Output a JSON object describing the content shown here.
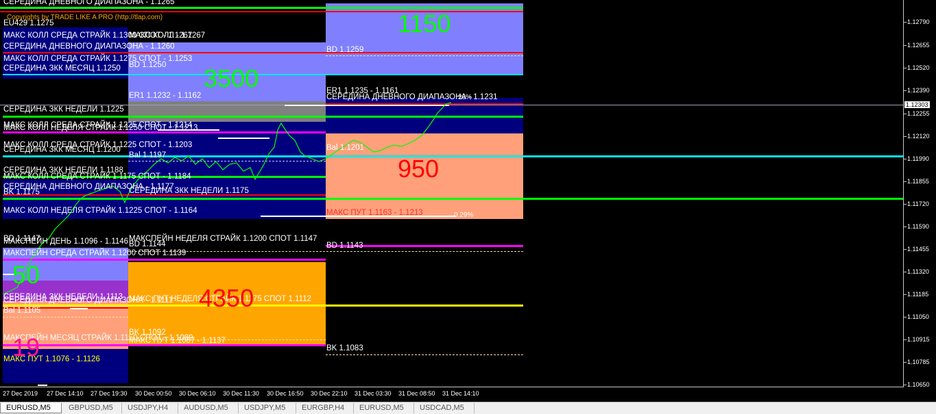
{
  "copyright": "Copyrights by TRADE LIKE A PRO (http://tlap.com)",
  "top_cut_label": "СЕРЕДИНА ДНЕВНОГО ДИАПАЗОНА - 1.1265",
  "labels": {
    "eu429": "EU429 1.1275",
    "maks_koll_sreda_1": "МАКС КОЛЛ СРЕДА  СТРАЙК 1.1300 СПОТ - 1.1267",
    "maks_koll_sreda_1b": "МАКС КОЛЛ - 1.1267",
    "ser_dnev_1": "СЕРЕДИНА ДНЕВНОГО ДИАПАЗОНА - 1.1260",
    "maks_koll_sreda_2": "МАКС КОЛЛ СРЕДА  СТРАЙК 1.1275 СПОТ - 1.1253",
    "ser_zkk_mes_1": "СЕРЕДИНА ЗКК МЕСЯЦ 1.1250",
    "ser_zkk_ned_1": "СЕРЕДИНА ЗКК НЕДЕЛИ 1.1225",
    "maks_koll_sreda_3": "МАКС КОЛЛ СРЕДА  СТРАЙК 1.1225 СПОТ - 1.1214",
    "maks_koll_ned_1": "МАКС КОЛЛ НЕДЕЛЯ СТРАЙК 1.1250 СПОТ - 1.1213",
    "maks_koll_sreda_4": "МАКС КОЛЛ СРЕДА  СТРАЙК 1.1225 СПОТ - 1.1203",
    "ser_zkk_mes_2": "СЕРЕДИНА ЗКК МЕСЯЦ 1.1200",
    "ser_zkk_ned_2": "СЕРЕДИНА ЗКК НЕДЕЛИ 1.1188",
    "maks_koll_sreda_5": "МАКС КОЛЛ СРЕДА  СТРАЙК 1.1175 СПОТ - 1.1184",
    "ser_dnev_2": "СЕРЕДИНА ДНЕВНОГО ДИАПАЗОНА - 1.1177",
    "ser_zkk_ned_3": "СЕРЕДИНА ЗКК НЕДЕЛИ 1.1175",
    "bk_1": "BK 1.1175",
    "maks_koll_ned_2": "МАКС КОЛЛ НЕДЕЛЯ СТРАЙК 1.1225 СПОТ - 1.1164",
    "bd_1": "BD 1.1147",
    "makspein_1": "МАКСПЕЙН  ДЕНЬ 1.1096 - 1.1146",
    "makspein_ned": "МАКСПЕЙН НЕДЕЛЯ  СТРАЙК 1.1200 СПОТ  1.1147",
    "bd_2": "BD 1.1144",
    "makspein_sreda": "МАКСПЕЙН СРЕДА  СТРАЙК 1.1200  СПОТ  1.1139",
    "ser_zkk_ned_4": "СЕРЕДИНА ЗКК НЕДЕЛИ 1.1113",
    "ser_dnev_3": "СЕРЕДИНА ДНЕВНОГО ДИАПАЗОНА - 1.1111",
    "maks_put_ned": "МАКС ПУТ НЕДЕЛЯ СТРАЙК 1.1175 СПОТ 1.1112",
    "bal_1": "Bal 1.1105",
    "bk_2": "BK 1.1092",
    "makspein_mes": "МАКСПЕЙН МЕСЯЦ  СТРАЙК 1.1150 СПОТ - 1.1089",
    "maks_put_2": "МАКС ПУТ 1.1087 - 1.1137",
    "maks_put_1": "МАКС ПУТ 1.1076 - 1.1126",
    "bd_3": "BD 1.1250",
    "er1_1": "ER1 1.1232 - 1.1162",
    "bal_2": "Bal 1.1197",
    "bd_4": "BD 1.1259",
    "er1_2": "ER1 1.1235 - 1.1161",
    "ser_dnev_4": "СЕРЕДИНА ДНЕВНОГО ДИАПАЗОНА - 1.1231",
    "pct_1": "26%",
    "bal_3": "Bal 1.1201",
    "maks_put_3": "МАКС ПУТ 1.1163 - 1.1213",
    "pct_2": "0.29%",
    "bd_5": "BD 1.1143",
    "bk_3": "BK 1.1083"
  },
  "big_numbers": {
    "n1150": "1150",
    "n3500": "3500",
    "n950": "950",
    "n50": "50",
    "n4350": "4350",
    "n19": "19"
  },
  "price_axis": {
    "ticks": [
      "1.12790",
      "1.12655",
      "1.12520",
      "1.12390",
      "1.12255",
      "1.12120",
      "1.11990",
      "1.11855",
      "1.11720",
      "1.11590",
      "1.11455",
      "1.11320",
      "1.11185",
      "1.11050",
      "1.10915",
      "1.10785",
      "1.10650"
    ],
    "current": "1.12303"
  },
  "time_axis": {
    "ticks": [
      "27 Dec 2019",
      "27 Dec 14:10",
      "27 Dec 19:30",
      "30 Dec 00:50",
      "30 Dec 06:10",
      "30 Dec 11:30",
      "30 Dec 16:50",
      "30 Dec 22:10",
      "31 Dec 03:30",
      "31 Dec 08:50",
      "31 Dec 14:10"
    ]
  },
  "tabs": [
    {
      "label": "EURUSD,M5",
      "active": true
    },
    {
      "label": "GBPUSD,M5",
      "active": false
    },
    {
      "label": "USDJPY,H4",
      "active": false
    },
    {
      "label": "AUDUSD,M5",
      "active": false
    },
    {
      "label": "USDJPY,M5",
      "active": false
    },
    {
      "label": "EURGBP,H4",
      "active": false
    },
    {
      "label": "EURUSD,M5",
      "active": false
    },
    {
      "label": "USDCAD,M5",
      "active": false
    }
  ],
  "colors": {
    "green_line": "#00ff00",
    "red_line": "#ff0000",
    "cyan_line": "#00e5ee",
    "magenta_line": "#ff00ff",
    "yellow_line": "#ffff00",
    "periwinkle": "#8080ff",
    "navy": "#00007f",
    "grey": "#808080",
    "salmon": "#ffa07a",
    "orange": "#ffa500",
    "purple": "#9932cc"
  }
}
